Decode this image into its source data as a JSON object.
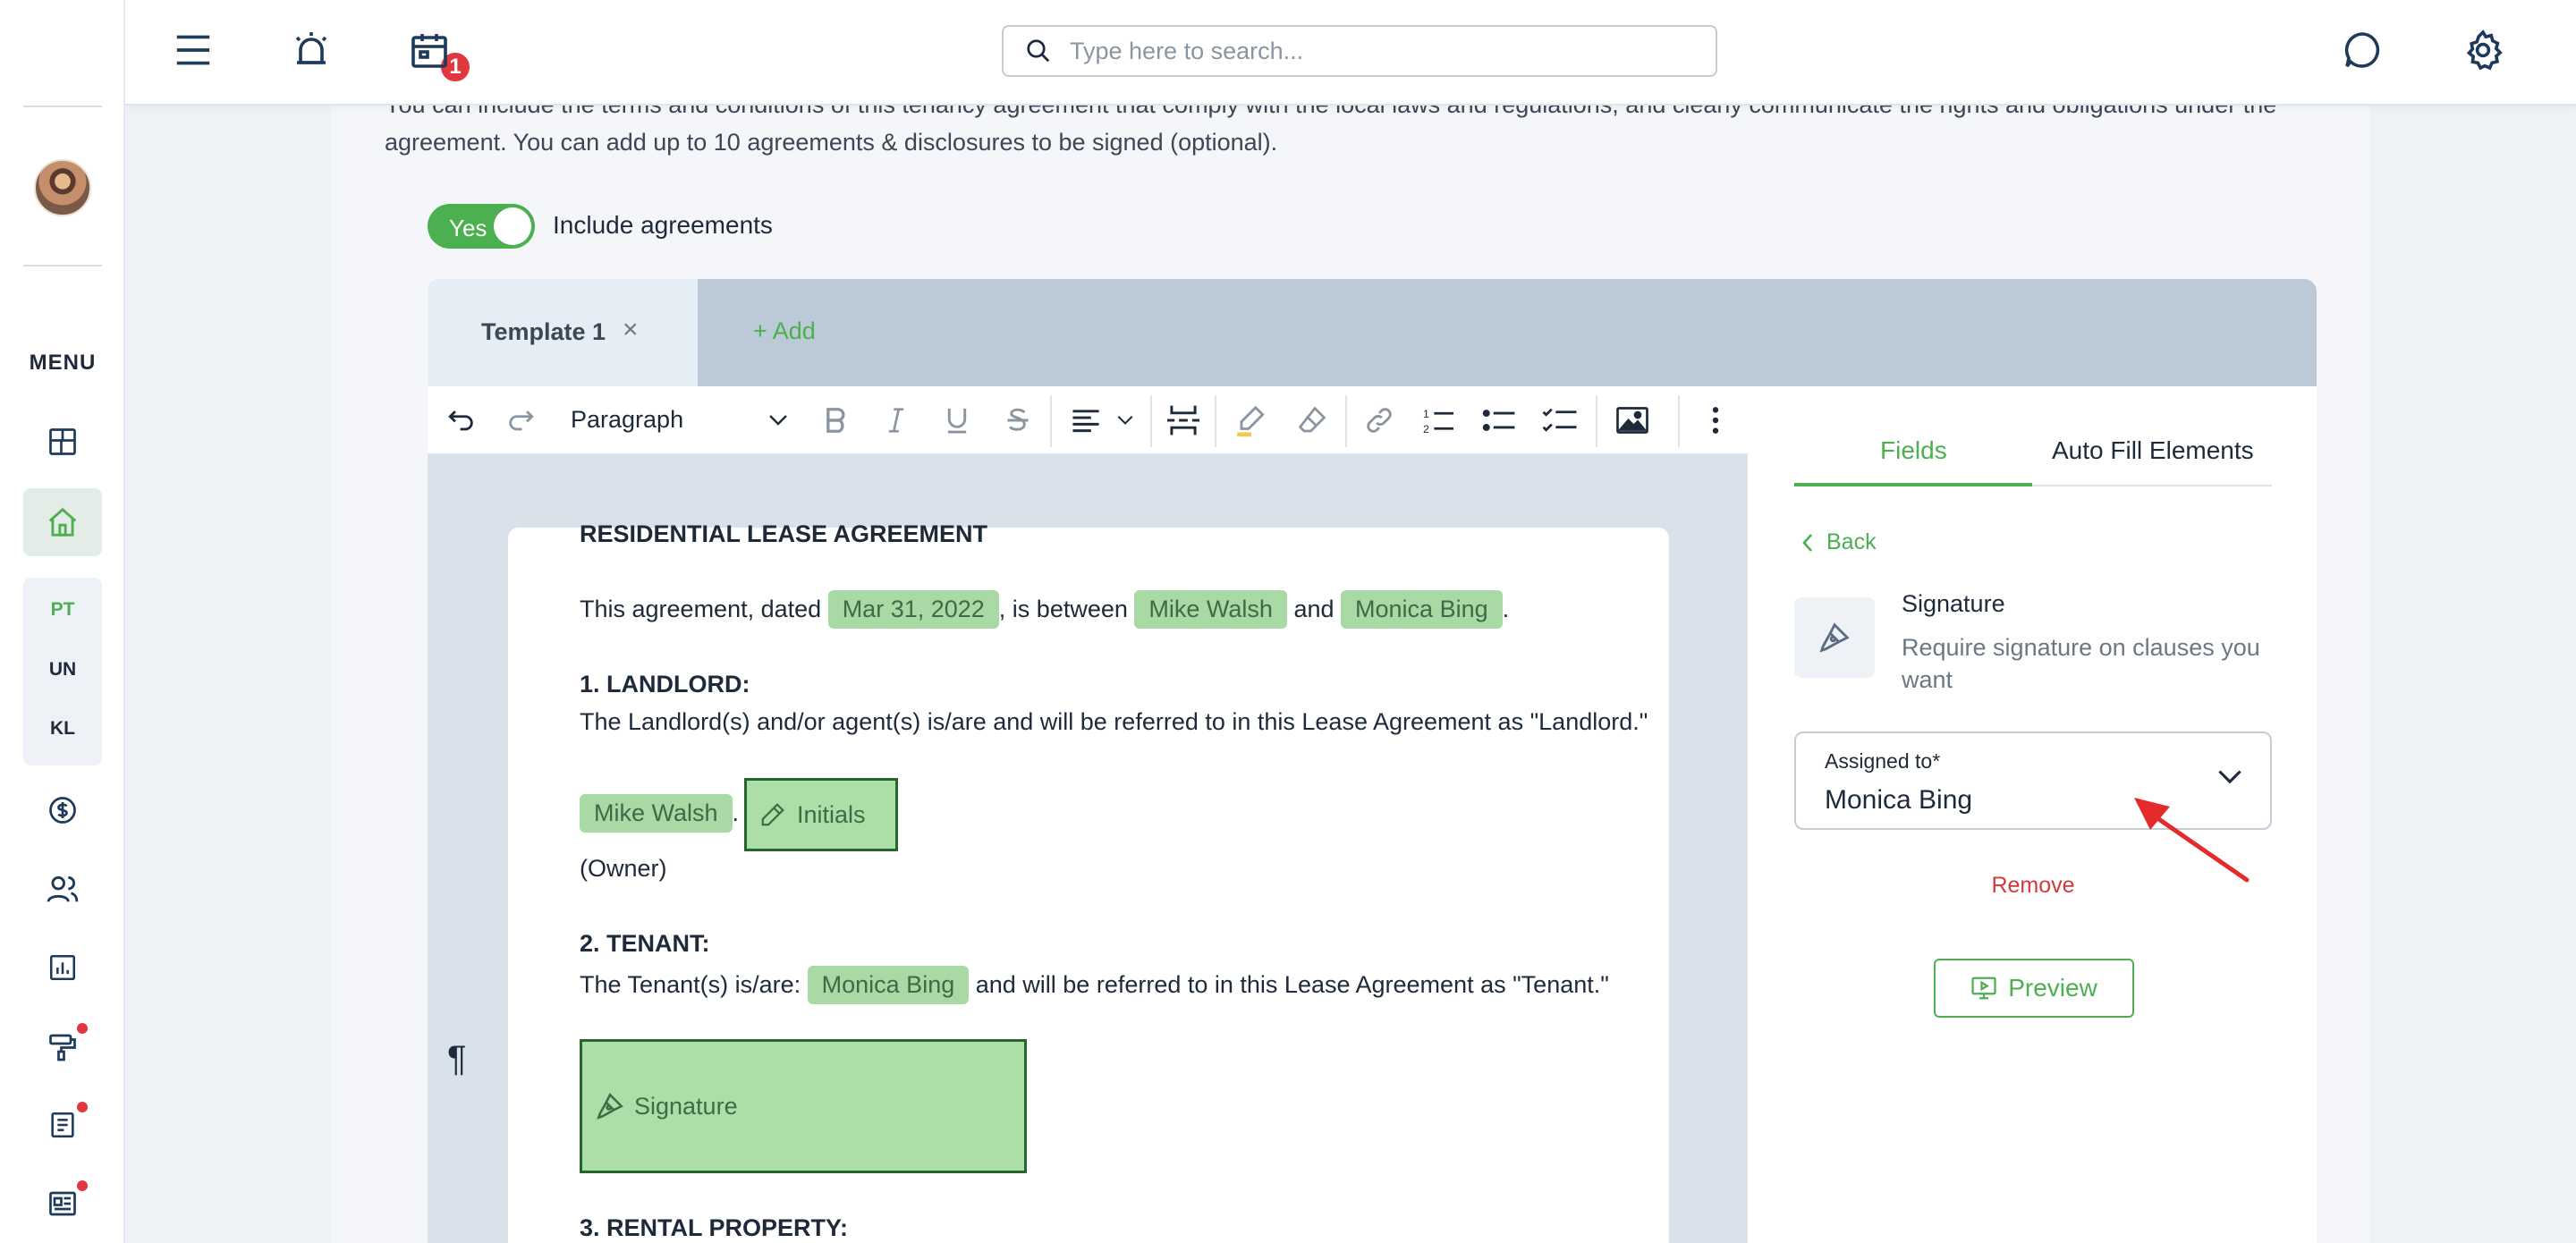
{
  "search": {
    "placeholder": "Type here to search..."
  },
  "notifications": {
    "count": "1"
  },
  "sidebar": {
    "menu_label": "MENU",
    "groups": [
      "PT",
      "UN",
      "KL"
    ]
  },
  "intro": {
    "text": "You can include the terms and conditions of this tenancy agreement that comply with the local laws and regulations, and clearly communicate the rights and obligations under the agreement. You can add up to 10 agreements & disclosures to be signed (optional)."
  },
  "agreements_toggle": {
    "state": "Yes",
    "label": "Include agreements"
  },
  "template_tabs": {
    "active": "Template 1",
    "close": "×",
    "add": "+ Add"
  },
  "toolbar": {
    "block_style": "Paragraph"
  },
  "document": {
    "title": "RESIDENTIAL LEASE AGREEMENT",
    "intro_pre": "This agreement, dated",
    "date": "Mar 31, 2022",
    "between": ", is between",
    "landlord_name": "Mike Walsh",
    "and": "and",
    "tenant_name": "Monica Bing",
    "period": ".",
    "section1_heading": "1. LANDLORD:",
    "section1_text": "The Landlord(s) and/or agent(s) is/are and will be referred to in this Lease Agreement as \"Landlord.\"",
    "initials_label": "Initials",
    "owner_note": "(Owner)",
    "section2_heading": "2. TENANT:",
    "section2_pre": "The Tenant(s) is/are:",
    "section2_post": "and will be referred to in this Lease Agreement as \"Tenant.\"",
    "signature_label": "Signature",
    "section3_heading": "3. RENTAL PROPERTY:",
    "pilcrow": "¶"
  },
  "right_panel": {
    "tabs": [
      "Fields",
      "Auto Fill Elements"
    ],
    "back": "Back",
    "field_title": "Signature",
    "field_desc": "Require signature on clauses you want",
    "assigned_label": "Assigned to*",
    "assigned_value": "Monica Bing",
    "remove": "Remove",
    "preview": "Preview"
  },
  "colors": {
    "accent": "#4caf50",
    "danger": "#d23a3a",
    "chip_bg": "#a9d9a5",
    "badge": "#e0383e"
  }
}
